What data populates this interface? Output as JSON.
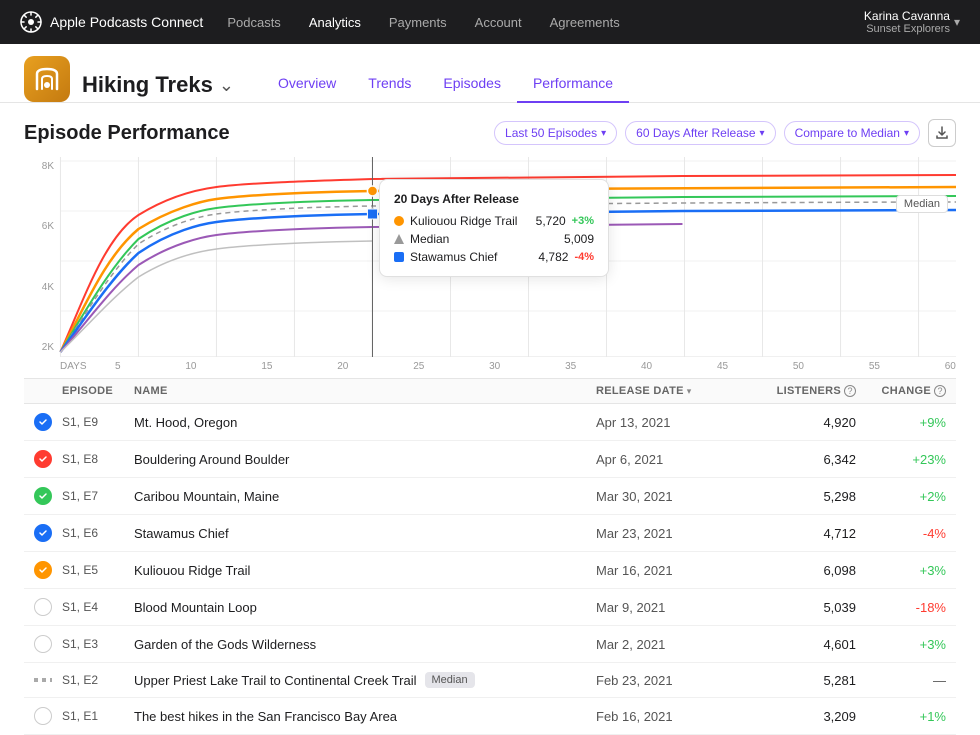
{
  "app": {
    "name": "Apple Podcasts Connect",
    "logo_alt": "apple-podcasts-logo"
  },
  "top_nav": {
    "links": [
      {
        "label": "Podcasts",
        "active": false
      },
      {
        "label": "Analytics",
        "active": true
      },
      {
        "label": "Payments",
        "active": false
      },
      {
        "label": "Account",
        "active": false
      },
      {
        "label": "Agreements",
        "active": false
      }
    ],
    "user": {
      "name": "Karina Cavanna",
      "subtitle": "Sunset Explorers",
      "chevron": "▾"
    }
  },
  "podcast": {
    "title": "Hiking Treks",
    "chevron": "⌄",
    "tabs": [
      {
        "label": "Overview",
        "active": false
      },
      {
        "label": "Trends",
        "active": false
      },
      {
        "label": "Episodes",
        "active": false
      },
      {
        "label": "Performance",
        "active": true
      }
    ]
  },
  "section": {
    "title": "Episode Performance",
    "filters": {
      "episodes": "Last 50 Episodes",
      "period": "60 Days After Release",
      "compare": "Compare to Median"
    }
  },
  "chart": {
    "y_labels": [
      "8K",
      "6K",
      "4K",
      "2K"
    ],
    "x_labels": [
      "DAYS",
      "5",
      "10",
      "15",
      "20",
      "25",
      "30",
      "35",
      "40",
      "45",
      "50",
      "55",
      "60"
    ],
    "median_label": "Median",
    "tooltip": {
      "title": "20 Days After Release",
      "rows": [
        {
          "type": "circle",
          "color": "orange",
          "label": "Kuliouou Ridge Trail",
          "value": "5,720",
          "change": "+3%",
          "change_type": "pos"
        },
        {
          "type": "triangle",
          "color": "gray",
          "label": "Median",
          "value": "5,009",
          "change": "",
          "change_type": ""
        },
        {
          "type": "square",
          "color": "blue",
          "label": "Stawamus Chief",
          "value": "4,782",
          "change": "-4%",
          "change_type": "neg"
        }
      ]
    }
  },
  "table": {
    "headers": [
      {
        "label": "",
        "key": "check"
      },
      {
        "label": "EPISODE",
        "key": "episode"
      },
      {
        "label": "NAME",
        "key": "name"
      },
      {
        "label": "RELEASE DATE",
        "key": "date",
        "sortable": true
      },
      {
        "label": "LISTENERS",
        "key": "listeners",
        "help": true
      },
      {
        "label": "CHANGE",
        "key": "change",
        "help": true
      }
    ],
    "rows": [
      {
        "check": "blue",
        "episode": "S1, E9",
        "name": "Mt. Hood, Oregon",
        "date": "Apr 13, 2021",
        "listeners": "4,920",
        "change": "+9%",
        "change_type": "pos",
        "median": false,
        "dash": false
      },
      {
        "check": "red",
        "episode": "S1, E8",
        "name": "Bouldering Around Boulder",
        "date": "Apr 6, 2021",
        "listeners": "6,342",
        "change": "+23%",
        "change_type": "pos",
        "median": false,
        "dash": false
      },
      {
        "check": "green",
        "episode": "S1, E7",
        "name": "Caribou Mountain, Maine",
        "date": "Mar 30, 2021",
        "listeners": "5,298",
        "change": "+2%",
        "change_type": "pos",
        "median": false,
        "dash": false
      },
      {
        "check": "blue",
        "episode": "S1, E6",
        "name": "Stawamus Chief",
        "date": "Mar 23, 2021",
        "listeners": "4,712",
        "change": "-4%",
        "change_type": "neg",
        "median": false,
        "dash": false
      },
      {
        "check": "orange",
        "episode": "S1, E5",
        "name": "Kuliouou Ridge Trail",
        "date": "Mar 16, 2021",
        "listeners": "6,098",
        "change": "+3%",
        "change_type": "pos",
        "median": false,
        "dash": false
      },
      {
        "check": "none",
        "episode": "S1, E4",
        "name": "Blood Mountain Loop",
        "date": "Mar 9, 2021",
        "listeners": "5,039",
        "change": "-18%",
        "change_type": "neg",
        "median": false,
        "dash": false
      },
      {
        "check": "none",
        "episode": "S1, E3",
        "name": "Garden of the Gods Wilderness",
        "date": "Mar 2, 2021",
        "listeners": "4,601",
        "change": "+3%",
        "change_type": "pos",
        "median": false,
        "dash": false
      },
      {
        "check": "dash",
        "episode": "S1, E2",
        "name": "Upper Priest Lake Trail to Continental Creek Trail",
        "date": "Feb 23, 2021",
        "listeners": "5,281",
        "change": "—",
        "change_type": "neutral",
        "median": true,
        "dash": true
      },
      {
        "check": "none",
        "episode": "S1, E1",
        "name": "The best hikes in the San Francisco Bay Area",
        "date": "Feb 16, 2021",
        "listeners": "3,209",
        "change": "+1%",
        "change_type": "pos",
        "median": false,
        "dash": false
      }
    ]
  }
}
